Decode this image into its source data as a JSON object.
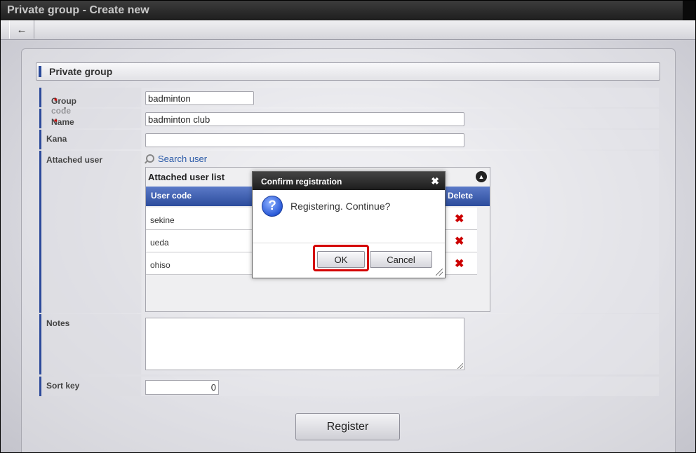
{
  "window": {
    "title": "Private group - Create new"
  },
  "toolbar": {
    "back_icon": "arrow-left-icon"
  },
  "section": {
    "title": "Private group"
  },
  "form": {
    "group_code": {
      "label": "Group code",
      "required_mark": "*",
      "value": "badminton"
    },
    "name": {
      "label": "Name",
      "required_mark": "*",
      "value": "badminton club"
    },
    "kana": {
      "label": "Kana",
      "value": ""
    },
    "attached_user": {
      "label": "Attached user",
      "search_link": "Search user",
      "list_title": "Attached user list",
      "columns": [
        "User code",
        "Delete"
      ],
      "rows": [
        {
          "code": "sekine",
          "delete_icon": "✖"
        },
        {
          "code": "ueda",
          "delete_icon": "✖"
        },
        {
          "code": "ohiso",
          "delete_icon": "✖"
        }
      ]
    },
    "notes": {
      "label": "Notes",
      "value": ""
    },
    "sort_key": {
      "label": "Sort key",
      "value": "0"
    }
  },
  "actions": {
    "register_label": "Register"
  },
  "dialog": {
    "title": "Confirm registration",
    "close_glyph": "✖",
    "icon_glyph": "?",
    "message": "Registering. Continue?",
    "ok_label": "OK",
    "cancel_label": "Cancel",
    "highlight_color": "#d40000"
  }
}
